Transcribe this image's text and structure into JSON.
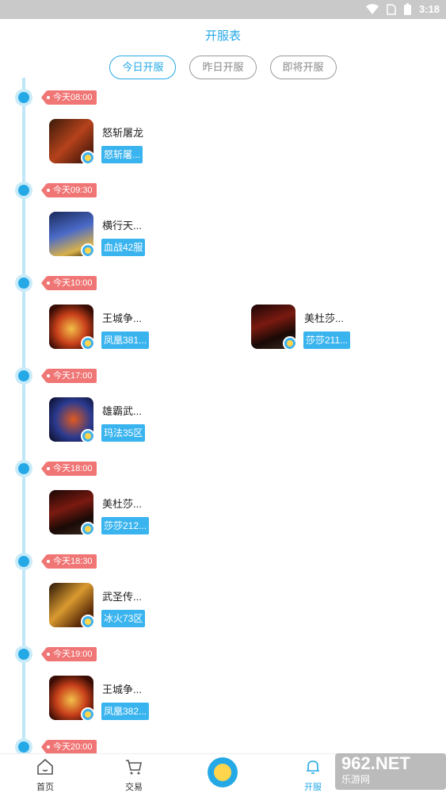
{
  "status_bar": {
    "time": "3:18"
  },
  "header": {
    "title": "开服表"
  },
  "tabs": [
    {
      "label": "今日开服",
      "active": true
    },
    {
      "label": "昨日开服",
      "active": false
    },
    {
      "label": "即将开服",
      "active": false
    }
  ],
  "timeline": [
    {
      "time": "今天08:00",
      "games": [
        {
          "name": "怒斩屠龙",
          "server": "怒斩屠..."
        }
      ]
    },
    {
      "time": "今天09:30",
      "games": [
        {
          "name": "横行天...",
          "server": "血战42服"
        }
      ]
    },
    {
      "time": "今天10:00",
      "games": [
        {
          "name": "王城争...",
          "server": "凤凰381..."
        },
        {
          "name": "美杜莎...",
          "server": "莎莎211..."
        }
      ]
    },
    {
      "time": "今天17:00",
      "games": [
        {
          "name": "雄霸武...",
          "server": "玛法35区"
        }
      ]
    },
    {
      "time": "今天18:00",
      "games": [
        {
          "name": "美杜莎...",
          "server": "莎莎212..."
        }
      ]
    },
    {
      "time": "今天18:30",
      "games": [
        {
          "name": "武圣传...",
          "server": "冰火73区"
        }
      ]
    },
    {
      "time": "今天19:00",
      "games": [
        {
          "name": "王城争...",
          "server": "凤凰382..."
        }
      ]
    },
    {
      "time": "今天20:00",
      "games": []
    }
  ],
  "bottom_nav": {
    "home": "首页",
    "trade": "交易",
    "open_server": "开服"
  },
  "watermark": {
    "brand": "962.NET",
    "sub": "乐游网"
  },
  "colors": {
    "accent": "#25a9e6",
    "time_tag": "#f07575",
    "server_tag": "#3ab4ee"
  }
}
